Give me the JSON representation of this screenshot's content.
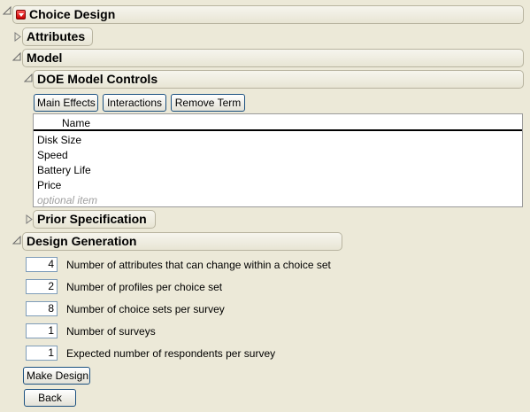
{
  "title": "Choice Design",
  "sections": {
    "attributes": "Attributes",
    "model": "Model",
    "doe_controls": "DOE Model Controls",
    "prior_spec": "Prior Specification",
    "design_generation": "Design Generation"
  },
  "buttons": {
    "main_effects": "Main Effects",
    "interactions": "Interactions",
    "remove_term": "Remove Term",
    "make_design": "Make Design",
    "back": "Back"
  },
  "model_list": {
    "header": "Name",
    "items": [
      "Disk Size",
      "Speed",
      "Battery Life",
      "Price"
    ],
    "optional": "optional item"
  },
  "design_fields": [
    {
      "value": "4",
      "label": "Number of attributes that can change within a choice set"
    },
    {
      "value": "2",
      "label": "Number of profiles per choice set"
    },
    {
      "value": "8",
      "label": "Number of choice sets per survey"
    },
    {
      "value": "1",
      "label": "Number of surveys"
    },
    {
      "value": "1",
      "label": "Expected number of respondents per survey"
    }
  ]
}
